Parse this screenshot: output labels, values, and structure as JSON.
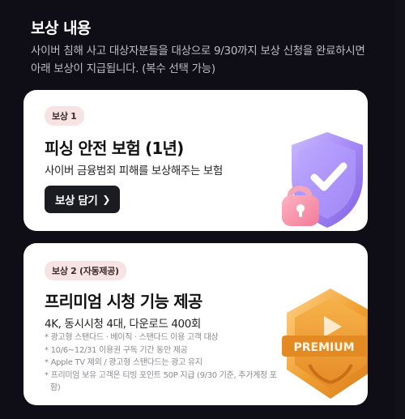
{
  "section": {
    "title": "보상 내용",
    "description": "사이버 침해 사고 대상자분들을 대상으로 9/30까지 보상 신청을 완료하시면 아래 보상이 지급됩니다. (복수 선택 가능)"
  },
  "rewards": [
    {
      "badge": "보상 1",
      "title": "피싱 안전 보험 (1년)",
      "subtitle": "사이버 금융범죄 피해를 보상해주는 보험",
      "button_label": "보상 담기",
      "art_icon": "shield-lock-check-icon"
    },
    {
      "badge": "보상 2 (자동제공)",
      "title": "프리미엄 시청 기능 제공",
      "subtitle": "4K, 동시시청 4대, 다운로드 400회",
      "notes": [
        "광고형 스탠다드 · 베이직 · 스탠다드 이용 고객 대상",
        "10/6~12/31 이용권 구독 기간 동안 제공",
        "Apple TV 제외 / 광고형 스탠다드는 광고 유지",
        "프리미엄 보유 고객은 티빙 포인트 50P 지급 (9/30 기준, 추가계정 포함)"
      ],
      "art_icon": "premium-medal-icon",
      "art_label": "PREMIUM"
    }
  ],
  "colors": {
    "background": "#0f0e17",
    "card": "#ffffff",
    "badge_bg": "#f7e3e3",
    "button_bg": "#1b1b22",
    "shield_purple": "#9b7cf5",
    "medal_orange": "#f0a032"
  }
}
